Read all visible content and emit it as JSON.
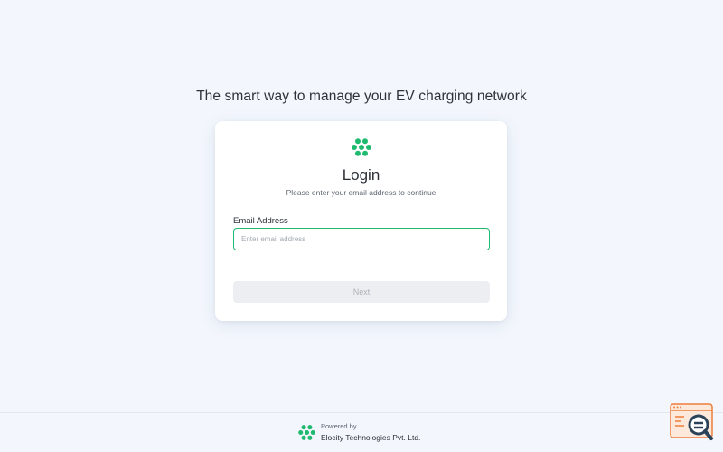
{
  "page": {
    "tagline": "The smart way to manage your EV charging network"
  },
  "login_card": {
    "logo_icon": "hexagon-cluster-logo-icon",
    "title": "Login",
    "subtitle": "Please enter your email address to continue",
    "email_label": "Email Address",
    "email_value": "",
    "email_placeholder": "Enter email address",
    "next_label": "Next",
    "next_disabled": true
  },
  "footer": {
    "logo_icon": "hexagon-cluster-logo-icon",
    "powered_by": "Powered by",
    "company": "Elocity Technologies Pvt. Ltd."
  },
  "corner_widget": {
    "icon": "search-document-icon"
  },
  "colors": {
    "background": "#f3f7fd",
    "brand_green": "#1fba70",
    "input_border_focus": "#1fba70",
    "button_disabled_bg": "#eceef1",
    "button_disabled_text": "#aeb3ba",
    "widget_accent": "#ee7d3b",
    "widget_dark": "#2a4359"
  }
}
